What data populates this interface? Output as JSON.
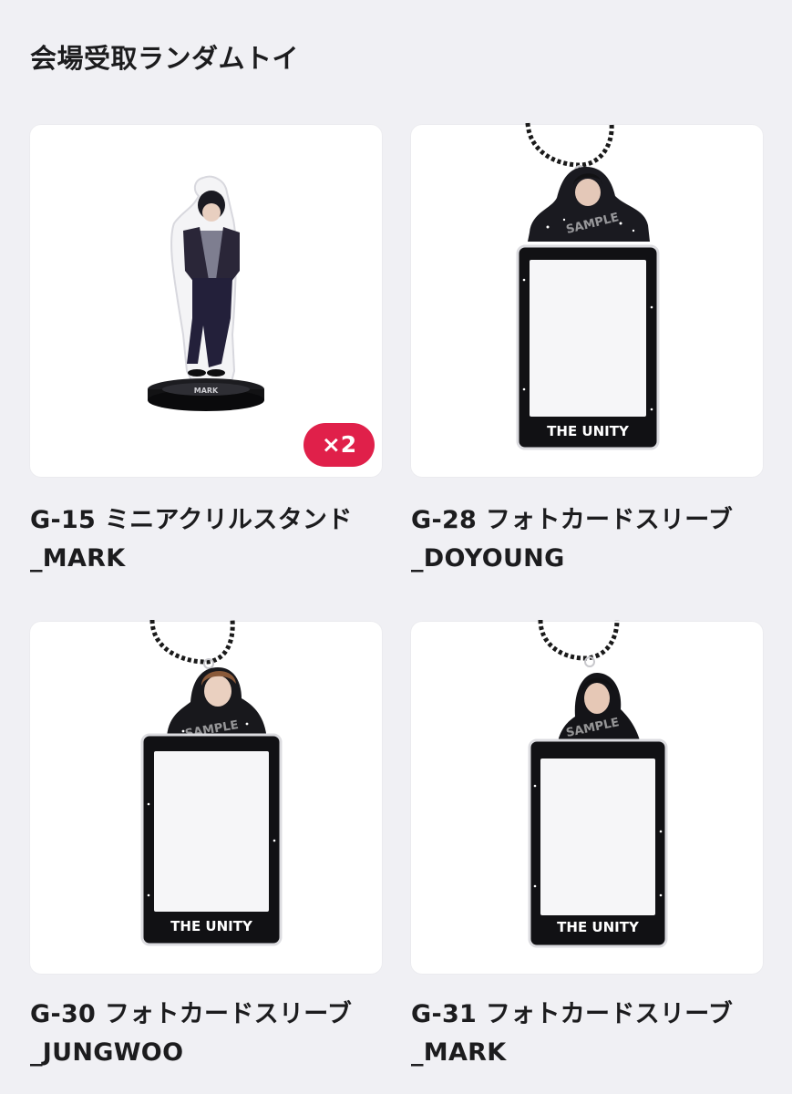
{
  "page": {
    "title": "会場受取ランダムトイ"
  },
  "items": [
    {
      "code_name": "G-15 ミニアクリルスタンド",
      "member": "_MARK",
      "quantity_badge": "×2",
      "product_type": "acrylic-stand",
      "stand_base_text": "MARK"
    },
    {
      "code_name": "G-28 フォトカードスリーブ",
      "member": "_DOYOUNG",
      "product_type": "photocard-sleeve",
      "sample_watermark": "SAMPLE",
      "sleeve_label": "THE UNITY"
    },
    {
      "code_name": "G-30 フォトカードスリーブ",
      "member": "_JUNGWOO",
      "product_type": "photocard-sleeve",
      "sample_watermark": "SAMPLE",
      "sleeve_label": "THE UNITY"
    },
    {
      "code_name": "G-31 フォトカードスリーブ",
      "member": "_MARK",
      "product_type": "photocard-sleeve",
      "sample_watermark": "SAMPLE",
      "sleeve_label": "THE UNITY"
    }
  ],
  "colors": {
    "background": "#f0f0f4",
    "card": "#ffffff",
    "badge": "#e0204a",
    "text": "#1c1c1e"
  }
}
